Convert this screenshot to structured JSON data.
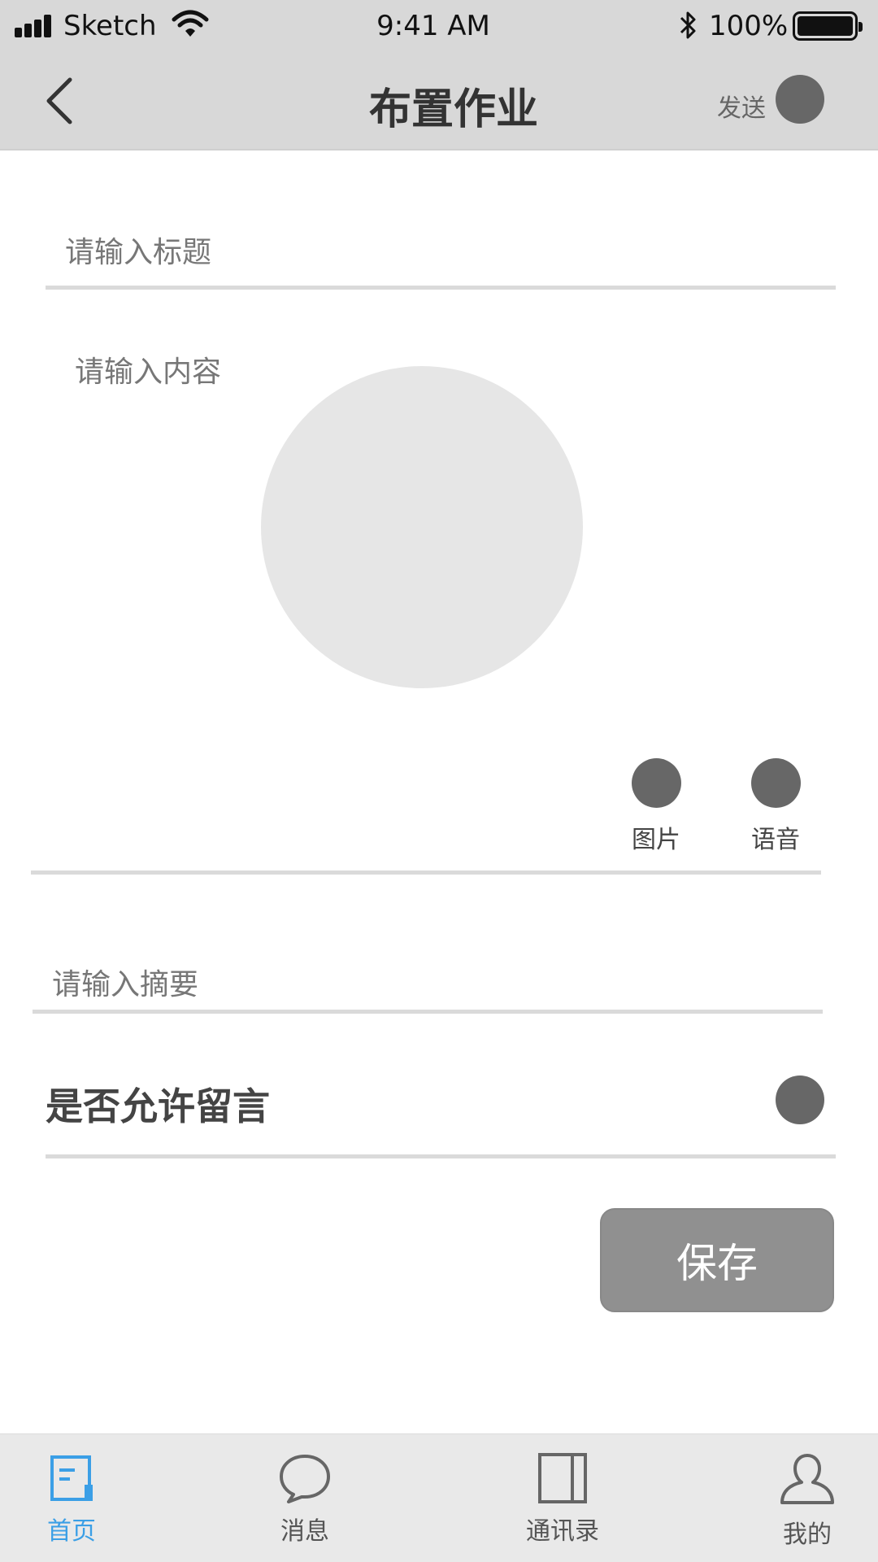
{
  "status_bar": {
    "carrier": "Sketch",
    "time": "9:41 AM",
    "battery": "100%"
  },
  "nav": {
    "title": "布置作业",
    "send_label": "发送",
    "back_icon": "chevron-left-icon"
  },
  "form": {
    "title_placeholder": "请输入标题",
    "content_placeholder": "请输入内容",
    "summary_placeholder": "请输入摘要",
    "tools": [
      {
        "label": "图片",
        "icon": "image-icon"
      },
      {
        "label": "语音",
        "icon": "voice-icon"
      }
    ],
    "allow_comment_label": "是否允许留言",
    "save_label": "保存"
  },
  "tabbar": {
    "items": [
      {
        "label": "首页",
        "icon": "home-doc-icon",
        "active": true
      },
      {
        "label": "消息",
        "icon": "chat-bubble-icon",
        "active": false
      },
      {
        "label": "通讯录",
        "icon": "contacts-book-icon",
        "active": false
      },
      {
        "label": "我的",
        "icon": "user-icon",
        "active": false
      }
    ]
  },
  "colors": {
    "header_bg": "#d8d8d8",
    "accent": "#3b9fe6",
    "placeholder_dot": "#676767",
    "save_button": "#909090"
  }
}
